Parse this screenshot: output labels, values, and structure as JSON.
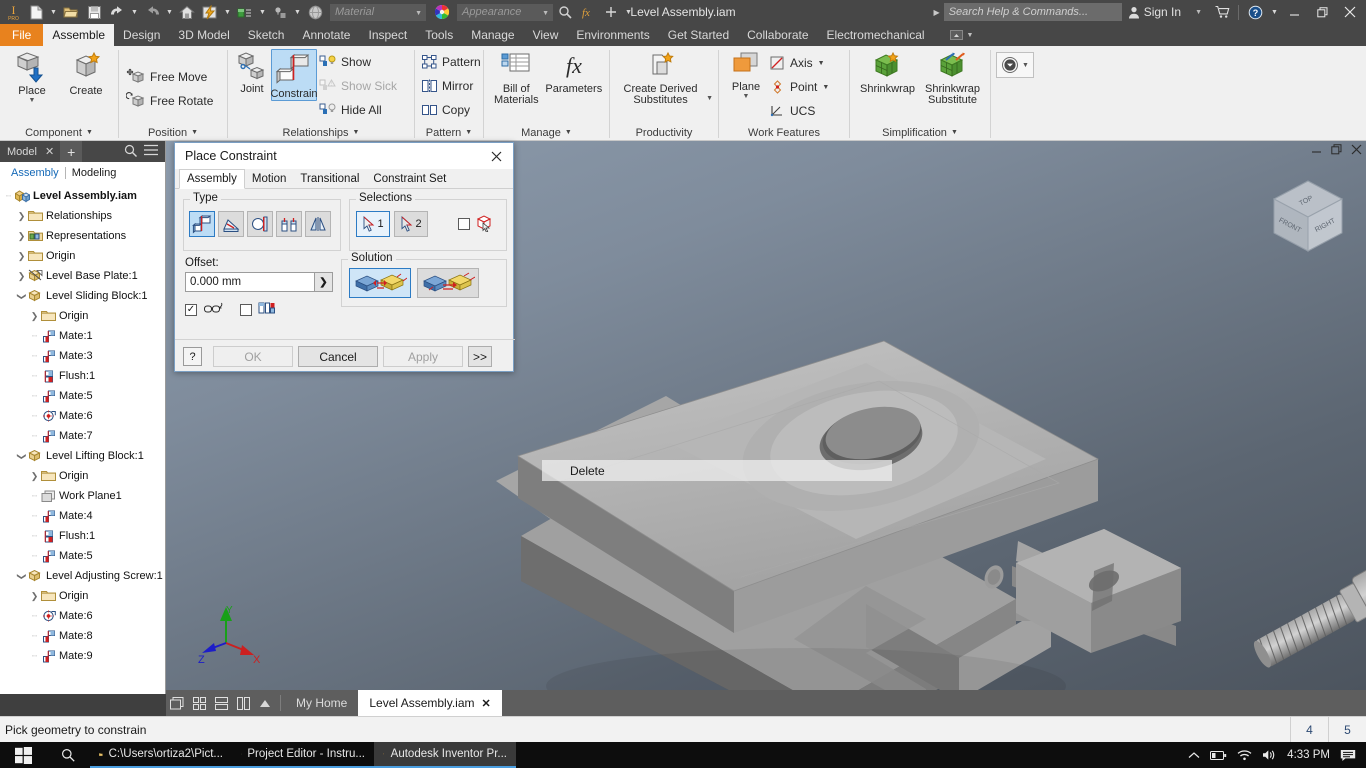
{
  "titlebar": {
    "document_title": "Level Assembly.iam",
    "search_placeholder": "Search Help & Commands...",
    "sign_in": "Sign In",
    "material_placeholder": "Material",
    "appearance_placeholder": "Appearance",
    "qat_icons": [
      "inventor-pro-logo",
      "new-icon",
      "new-dropdown",
      "open-icon",
      "save-icon",
      "undo-icon",
      "undo-dropdown",
      "redo-icon",
      "redo-dropdown",
      "home-icon",
      "update-icon",
      "update-dropdown",
      "return-icon",
      "return-dropdown",
      "select-icon",
      "select-dropdown",
      "appearance-sphere-icon"
    ],
    "window_buttons": [
      "minimize",
      "restore",
      "close"
    ],
    "cart_icon": "cart-icon",
    "help_icon": "help-icon"
  },
  "menu": {
    "file_label": "File",
    "tabs": [
      {
        "label": "Assemble",
        "active": true
      },
      {
        "label": "Design",
        "active": false
      },
      {
        "label": "3D Model",
        "active": false
      },
      {
        "label": "Sketch",
        "active": false
      },
      {
        "label": "Annotate",
        "active": false
      },
      {
        "label": "Inspect",
        "active": false
      },
      {
        "label": "Tools",
        "active": false
      },
      {
        "label": "Manage",
        "active": false
      },
      {
        "label": "View",
        "active": false
      },
      {
        "label": "Environments",
        "active": false
      },
      {
        "label": "Get Started",
        "active": false
      },
      {
        "label": "Collaborate",
        "active": false
      },
      {
        "label": "Electromechanical",
        "active": false
      }
    ]
  },
  "ribbon": {
    "panels": [
      {
        "label": "Component",
        "has_dropdown": true,
        "big_buttons": [
          {
            "label": "Place",
            "icon": "place-component-icon",
            "has_dropdown": true
          },
          {
            "label": "Create",
            "icon": "create-component-icon",
            "has_dropdown": false
          }
        ]
      },
      {
        "label": "Position",
        "has_dropdown": true,
        "small_buttons": [
          {
            "label": "Free Move",
            "icon": "free-move-icon",
            "disabled": false
          },
          {
            "label": "Free Rotate",
            "icon": "free-rotate-icon",
            "disabled": false
          }
        ]
      },
      {
        "label": "Relationships",
        "has_dropdown": true,
        "big_buttons": [
          {
            "label": "Joint",
            "icon": "joint-icon",
            "selected": false
          },
          {
            "label": "Constrain",
            "icon": "constrain-icon",
            "selected": true
          }
        ],
        "small_buttons": [
          {
            "label": "Show",
            "icon": "show-relationships-icon",
            "disabled": false
          },
          {
            "label": "Show Sick",
            "icon": "show-sick-icon",
            "disabled": true
          },
          {
            "label": "Hide All",
            "icon": "hide-all-icon",
            "disabled": false
          }
        ]
      },
      {
        "label": "Pattern",
        "has_dropdown": true,
        "small_buttons": [
          {
            "label": "Pattern",
            "icon": "pattern-icon",
            "disabled": false
          },
          {
            "label": "Mirror",
            "icon": "mirror-icon",
            "disabled": false
          },
          {
            "label": "Copy",
            "icon": "copy-icon",
            "disabled": false
          }
        ]
      },
      {
        "label": "Manage",
        "has_dropdown": true,
        "big_buttons": [
          {
            "label": "Bill of\nMaterials",
            "icon": "bill-of-materials-icon"
          },
          {
            "label": "Parameters",
            "icon": "parameters-fx-icon"
          }
        ]
      },
      {
        "label": "Productivity",
        "has_dropdown": false,
        "big_buttons": [
          {
            "label": "Create Derived\nSubstitutes",
            "icon": "create-derived-substitutes-icon",
            "has_dropdown": true
          }
        ]
      },
      {
        "label": "Work Features",
        "has_dropdown": false,
        "big_buttons": [
          {
            "label": "Plane",
            "icon": "work-plane-icon",
            "has_dropdown": true
          }
        ],
        "small_buttons": [
          {
            "label": "Axis",
            "icon": "work-axis-icon",
            "has_dropdown": true
          },
          {
            "label": "Point",
            "icon": "work-point-icon",
            "has_dropdown": true
          },
          {
            "label": "UCS",
            "icon": "ucs-icon",
            "has_dropdown": false
          }
        ]
      },
      {
        "label": "Simplification",
        "has_dropdown": true,
        "big_buttons": [
          {
            "label": "Shrinkwrap",
            "icon": "shrinkwrap-icon"
          },
          {
            "label": "Shrinkwrap\nSubstitute",
            "icon": "shrinkwrap-substitute-icon"
          }
        ]
      },
      {
        "label": "",
        "has_dropdown": false,
        "big_buttons": [
          {
            "label": "",
            "icon": "convert-icon",
            "has_dropdown": true
          }
        ]
      }
    ]
  },
  "browser": {
    "panel_title": "Model",
    "close_icon": "close-icon",
    "add_icon": "plus-icon",
    "search_icon": "search-icon",
    "menu_icon": "hamburger-menu-icon",
    "subtabs": [
      {
        "label": "Assembly",
        "active": true
      },
      {
        "label": "Modeling",
        "active": false
      }
    ],
    "tree": [
      {
        "label": "Level Assembly.iam",
        "indent": 0,
        "twisty": "",
        "icon": "assembly-icon",
        "root": true
      },
      {
        "label": "Relationships",
        "indent": 1,
        "twisty": "collapsed",
        "icon": "folder-icon"
      },
      {
        "label": "Representations",
        "indent": 1,
        "twisty": "collapsed",
        "icon": "representations-icon"
      },
      {
        "label": "Origin",
        "indent": 1,
        "twisty": "collapsed",
        "icon": "folder-icon"
      },
      {
        "label": "Level Base Plate:1",
        "indent": 1,
        "twisty": "collapsed",
        "icon": "grounded-part-icon"
      },
      {
        "label": "Level Sliding Block:1",
        "indent": 1,
        "twisty": "expanded",
        "icon": "part-icon"
      },
      {
        "label": "Origin",
        "indent": 2,
        "twisty": "collapsed",
        "icon": "folder-icon"
      },
      {
        "label": "Mate:1",
        "indent": 2,
        "twisty": "",
        "icon": "mate-icon"
      },
      {
        "label": "Mate:3",
        "indent": 2,
        "twisty": "",
        "icon": "mate-icon"
      },
      {
        "label": "Flush:1",
        "indent": 2,
        "twisty": "",
        "icon": "flush-icon"
      },
      {
        "label": "Mate:5",
        "indent": 2,
        "twisty": "",
        "icon": "mate-icon"
      },
      {
        "label": "Mate:6",
        "indent": 2,
        "twisty": "",
        "icon": "insert-icon"
      },
      {
        "label": "Mate:7",
        "indent": 2,
        "twisty": "",
        "icon": "mate-icon"
      },
      {
        "label": "Level Lifting Block:1",
        "indent": 1,
        "twisty": "expanded",
        "icon": "part-icon"
      },
      {
        "label": "Origin",
        "indent": 2,
        "twisty": "collapsed",
        "icon": "folder-icon"
      },
      {
        "label": "Work Plane1",
        "indent": 2,
        "twisty": "",
        "icon": "work-plane-tree-icon"
      },
      {
        "label": "Mate:4",
        "indent": 2,
        "twisty": "",
        "icon": "mate-icon"
      },
      {
        "label": "Flush:1",
        "indent": 2,
        "twisty": "",
        "icon": "flush-icon"
      },
      {
        "label": "Mate:5",
        "indent": 2,
        "twisty": "",
        "icon": "mate-icon"
      },
      {
        "label": "Level Adjusting Screw:1",
        "indent": 1,
        "twisty": "expanded",
        "icon": "part-icon"
      },
      {
        "label": "Origin",
        "indent": 2,
        "twisty": "collapsed",
        "icon": "folder-icon"
      },
      {
        "label": "Mate:6",
        "indent": 2,
        "twisty": "",
        "icon": "insert-icon"
      },
      {
        "label": "Mate:8",
        "indent": 2,
        "twisty": "",
        "icon": "mate-icon"
      },
      {
        "label": "Mate:9",
        "indent": 2,
        "twisty": "",
        "icon": "mate-icon"
      }
    ]
  },
  "dialog": {
    "title": "Place Constraint",
    "close_icon": "close-icon",
    "tabs": [
      {
        "label": "Assembly",
        "active": true
      },
      {
        "label": "Motion",
        "active": false
      },
      {
        "label": "Transitional",
        "active": false
      },
      {
        "label": "Constraint Set",
        "active": false
      }
    ],
    "type_group_label": "Type",
    "type_buttons": [
      {
        "name": "mate-constraint",
        "selected": true
      },
      {
        "name": "angle-constraint",
        "selected": false
      },
      {
        "name": "tangent-constraint",
        "selected": false
      },
      {
        "name": "insert-constraint",
        "selected": false
      },
      {
        "name": "symmetry-constraint",
        "selected": false
      }
    ],
    "selections_group_label": "Selections",
    "selection_buttons": [
      {
        "label": "1",
        "selected": true
      },
      {
        "label": "2",
        "selected": false
      }
    ],
    "pick_part_first_checked": false,
    "offset_label": "Offset:",
    "offset_value": "0.000 mm",
    "offset_expand_icon": "chevron-right-icon",
    "show_preview_checked": true,
    "predict_offset_checked": false,
    "solution_group_label": "Solution",
    "solution_buttons": [
      {
        "name": "solution-opposed",
        "selected": true
      },
      {
        "name": "solution-aligned",
        "selected": false
      }
    ],
    "help_label": "?",
    "buttons": [
      {
        "label": "OK",
        "disabled": true
      },
      {
        "label": "Cancel",
        "disabled": false
      },
      {
        "label": "Apply",
        "disabled": true
      },
      {
        "label": ">>",
        "disabled": false
      }
    ]
  },
  "viewport": {
    "context_tooltip": "Delete",
    "viewcube_faces": {
      "top": "TOP",
      "front": "FRONT",
      "right": "RIGHT"
    },
    "axis_labels": {
      "x": "X",
      "y": "Y",
      "z": "Z"
    },
    "axis_colors": {
      "x": "#cc2020",
      "y": "#18a018",
      "z": "#1d1dc8"
    },
    "window_buttons": [
      "minimize",
      "restore",
      "close"
    ]
  },
  "doctabs": {
    "view_icons": [
      "tile-windows-icon",
      "grid-view-icon",
      "horizontal-split-icon",
      "vertical-split-icon",
      "expand-up-icon"
    ],
    "tabs": [
      {
        "label": "My Home",
        "active": false,
        "closable": false
      },
      {
        "label": "Level Assembly.iam",
        "active": true,
        "closable": true
      }
    ]
  },
  "statusbar": {
    "message": "Pick geometry to constrain",
    "cells": [
      "4",
      "5"
    ]
  },
  "taskbar": {
    "start_icon": "windows-start-icon",
    "search_icon": "search-icon",
    "apps": [
      {
        "label": "C:\\Users\\ortiza2\\Pict...",
        "icon": "folder-icon",
        "active": false
      },
      {
        "label": "Project Editor - Instru...",
        "icon": "chrome-icon",
        "active": false
      },
      {
        "label": "Autodesk Inventor Pr...",
        "icon": "inventor-icon",
        "active": true
      }
    ],
    "tray_icons": [
      "chevron-up-icon",
      "battery-icon",
      "wifi-icon",
      "volume-icon"
    ],
    "clock": "4:33 PM",
    "notification_icon": "notifications-icon"
  },
  "colors": {
    "accent_orange": "#e8821e",
    "ribbon_bg": "#f0f0f0",
    "chrome_dark": "#474747",
    "selection_blue": "#bcdcf5",
    "selection_border": "#2c7bc4"
  }
}
